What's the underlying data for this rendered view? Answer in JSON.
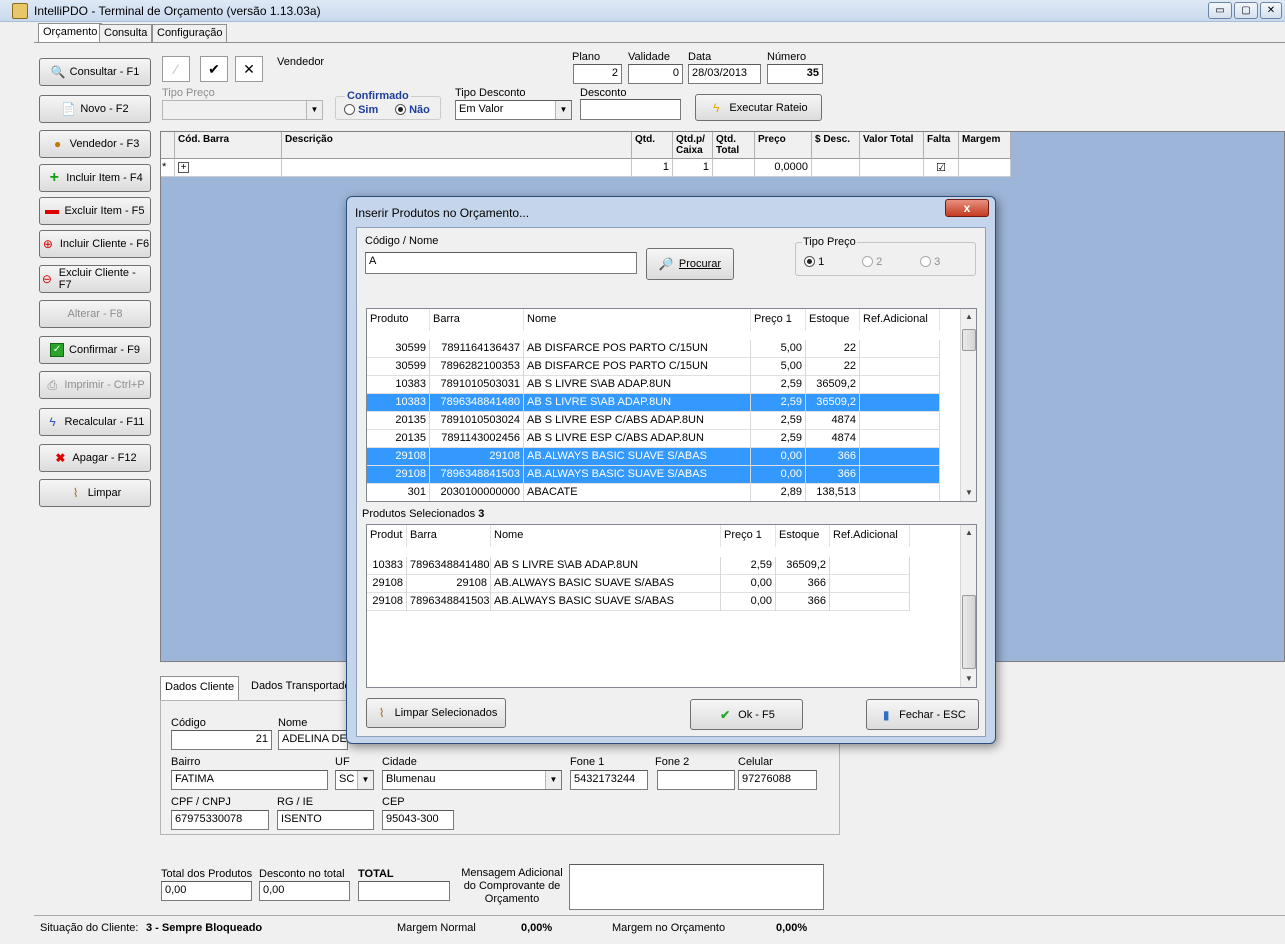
{
  "window": {
    "title": "IntelliPDO - Terminal de Orçamento  (versão 1.13.03a)"
  },
  "menu_tabs": [
    "Orçamento",
    "Consulta",
    "Configuração"
  ],
  "left_buttons": [
    {
      "label": "Consultar - F1",
      "icon": "magnifier-icon",
      "enabled": true
    },
    {
      "label": "Novo - F2",
      "icon": "new-document-icon",
      "enabled": true
    },
    {
      "label": "Vendedor - F3",
      "icon": "person-icon",
      "enabled": true
    },
    {
      "label": "Incluir Item - F4",
      "icon": "plus-icon",
      "enabled": true
    },
    {
      "label": "Excluir Item - F5",
      "icon": "minus-icon",
      "enabled": true
    },
    {
      "label": "Incluir Cliente - F6",
      "icon": "add-client-icon",
      "enabled": true
    },
    {
      "label": "Excluir Cliente - F7",
      "icon": "remove-client-icon",
      "enabled": true
    },
    {
      "label": "Alterar - F8",
      "icon": "",
      "enabled": false
    },
    {
      "label": "Confirmar - F9",
      "icon": "checkmark-icon",
      "enabled": true
    },
    {
      "label": "Imprimir - Ctrl+P",
      "icon": "printer-icon",
      "enabled": false
    },
    {
      "label": "Recalcular - F11",
      "icon": "lightning-icon",
      "enabled": true
    },
    {
      "label": "Apagar - F12",
      "icon": "red-x-icon",
      "enabled": true
    },
    {
      "label": "Limpar",
      "icon": "broom-icon",
      "enabled": true
    }
  ],
  "header": {
    "vendedor_label": "Vendedor",
    "plano_label": "Plano",
    "plano_value": "2",
    "validade_label": "Validade",
    "validade_value": "0",
    "data_label": "Data",
    "data_value": "28/03/2013",
    "numero_label": "Número",
    "numero_value": "35",
    "tipo_preco_label": "Tipo Preço",
    "confirmado_label": "Confirmado",
    "sim_label": "Sim",
    "nao_label": "Não",
    "tipo_desconto_label": "Tipo Desconto",
    "tipo_desconto_value": "Em Valor",
    "desconto_label": "Desconto",
    "desconto_value": "",
    "rateio_label": "Executar Rateio"
  },
  "items_grid": {
    "columns": [
      "Cód. Barra",
      "Descrição",
      "Qtd.",
      "Qtd.p/ Caixa",
      "Qtd. Total",
      "Preço",
      "$ Desc.",
      "Valor Total",
      "Falta",
      "Margem"
    ],
    "row": {
      "marker": "*",
      "expand": "+",
      "qtd": "1",
      "qtd_caixa": "1",
      "preco": "0,0000",
      "falta": "☑"
    }
  },
  "bottom_tabs": [
    "Dados Cliente",
    "Dados Transportado"
  ],
  "client": {
    "codigo_label": "Código",
    "codigo_value": "21",
    "nome_label": "Nome",
    "nome_value": "ADELINA DE M",
    "bairro_label": "Bairro",
    "bairro_value": "FATIMA",
    "uf_label": "UF",
    "uf_value": "SC",
    "cidade_label": "Cidade",
    "cidade_value": "Blumenau",
    "fone1_label": "Fone 1",
    "fone1_value": "5432173244",
    "fone2_label": "Fone 2",
    "fone2_value": "",
    "celular_label": "Celular",
    "celular_value": "97276088",
    "cpf_label": "CPF / CNPJ",
    "cpf_value": "67975330078",
    "rg_label": "RG / IE",
    "rg_value": "ISENTO",
    "cep_label": "CEP",
    "cep_value": "95043-300"
  },
  "totals": {
    "total_produtos_label": "Total dos Produtos",
    "total_produtos_value": "0,00",
    "desconto_total_label": "Desconto no total",
    "desconto_total_value": "0,00",
    "total_label": "TOTAL",
    "total_value": "",
    "mensagem_label": "Mensagem Adicional do Comprovante de Orçamento"
  },
  "status": {
    "situacao_label": "Situação do Cliente:",
    "situacao_value": "3 - Sempre Bloqueado",
    "margem_normal_label": "Margem Normal",
    "margem_normal_value": "0,00%",
    "margem_orcamento_label": "Margem no Orçamento",
    "margem_orcamento_value": "0,00%"
  },
  "dialog": {
    "title": "Inserir Produtos no Orçamento...",
    "close_label": "x",
    "codigo_nome_label": "Código / Nome",
    "search_value": "A",
    "procurar_label": "Procurar",
    "tipo_preco_label": "Tipo Preço",
    "tipo_preco_options": [
      "1",
      "2",
      "3"
    ],
    "products_columns": [
      "Produto",
      "Barra",
      "Nome",
      "Preço 1",
      "Estoque",
      "Ref.Adicional"
    ],
    "products": [
      {
        "produto": "30599",
        "barra": "7891164136437",
        "nome": "AB DISFARCE POS PARTO C/15UN",
        "preco": "5,00",
        "estoque": "22",
        "selected": false
      },
      {
        "produto": "30599",
        "barra": "7896282100353",
        "nome": "AB DISFARCE POS PARTO C/15UN",
        "preco": "5,00",
        "estoque": "22",
        "selected": false
      },
      {
        "produto": "10383",
        "barra": "7891010503031",
        "nome": "AB S  LIVRE S\\AB ADAP.8UN",
        "preco": "2,59",
        "estoque": "36509,2",
        "selected": false
      },
      {
        "produto": "10383",
        "barra": "7896348841480",
        "nome": "AB S  LIVRE S\\AB ADAP.8UN",
        "preco": "2,59",
        "estoque": "36509,2",
        "selected": true
      },
      {
        "produto": "20135",
        "barra": "7891010503024",
        "nome": "AB S LIVRE ESP C/ABS ADAP.8UN",
        "preco": "2,59",
        "estoque": "4874",
        "selected": false
      },
      {
        "produto": "20135",
        "barra": "7891143002456",
        "nome": "AB S LIVRE ESP C/ABS ADAP.8UN",
        "preco": "2,59",
        "estoque": "4874",
        "selected": false
      },
      {
        "produto": "29108",
        "barra": "29108",
        "nome": "AB.ALWAYS BASIC SUAVE S/ABAS",
        "preco": "0,00",
        "estoque": "366",
        "selected": true
      },
      {
        "produto": "29108",
        "barra": "7896348841503",
        "nome": "AB.ALWAYS BASIC SUAVE S/ABAS",
        "preco": "0,00",
        "estoque": "366",
        "selected": true
      },
      {
        "produto": "301",
        "barra": "2030100000000",
        "nome": "ABACATE",
        "preco": "2,89",
        "estoque": "138,513",
        "selected": false
      }
    ],
    "selected_label": "Produtos Selecionados",
    "selected_count": "3",
    "selected_columns": [
      "Produt",
      "Barra",
      "Nome",
      "Preço 1",
      "Estoque",
      "Ref.Adicional"
    ],
    "selected_products": [
      {
        "produto": "10383",
        "barra": "7896348841480",
        "nome": "AB S  LIVRE S\\AB ADAP.8UN",
        "preco": "2,59",
        "estoque": "36509,2"
      },
      {
        "produto": "29108",
        "barra": "29108",
        "nome": "AB.ALWAYS BASIC SUAVE S/ABAS",
        "preco": "0,00",
        "estoque": "366"
      },
      {
        "produto": "29108",
        "barra": "7896348841503",
        "nome": "AB.ALWAYS BASIC SUAVE S/ABAS",
        "preco": "0,00",
        "estoque": "366"
      }
    ],
    "limpar_label": "Limpar Selecionados",
    "ok_label": "Ok - F5",
    "fechar_label": "Fechar - ESC"
  }
}
